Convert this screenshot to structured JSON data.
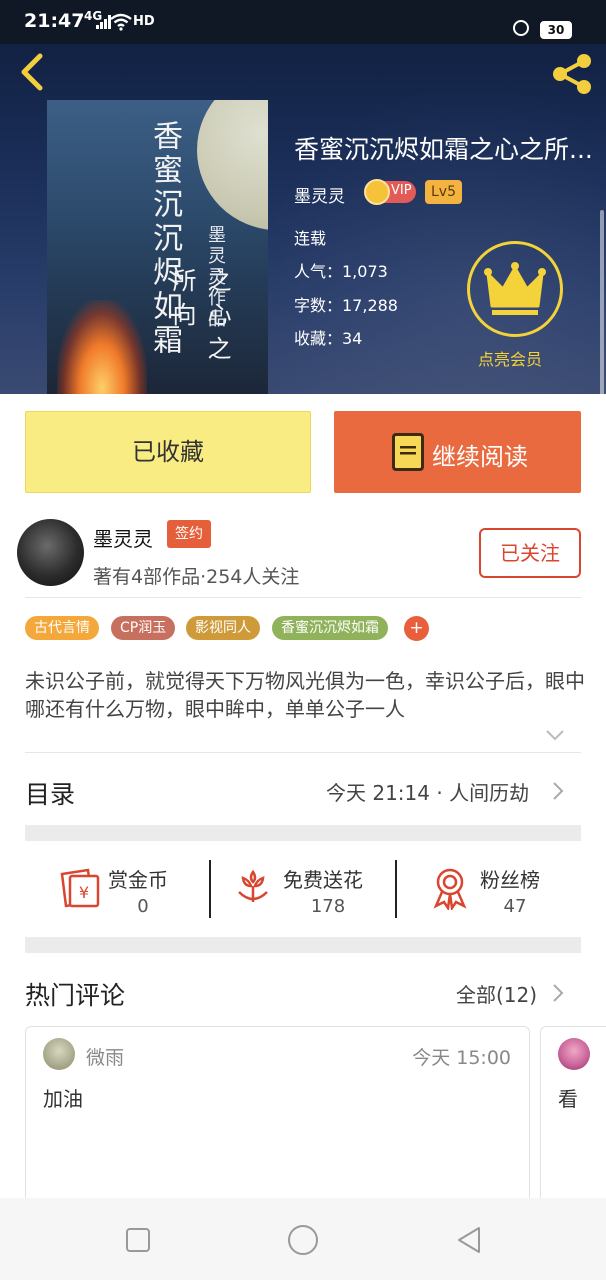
{
  "status_bar": {
    "time": "21:47",
    "network": "4G",
    "hd": "HD",
    "battery": "30"
  },
  "book": {
    "title": "香蜜沉沉烬如霜之心之所...",
    "author": "墨灵灵",
    "vip_label": "VIP",
    "level": "Lv5",
    "status": "连载",
    "popularity": "人气：1,073",
    "word_count": "字数：17,288",
    "favorites": "收藏：34",
    "member_label": "点亮会员",
    "cover": {
      "title": "香蜜沉沉烬如霜",
      "subtitle": "之心之所向",
      "author_line": "墨灵灵作品"
    }
  },
  "actions": {
    "collected": "已收藏",
    "continue_read": "继续阅读"
  },
  "author": {
    "name": "墨灵灵",
    "signed_badge": "签约",
    "stats": "著有4部作品·254人关注",
    "follow": "已关注"
  },
  "tags": [
    {
      "label": "古代言情",
      "color": "#f4a73b"
    },
    {
      "label": "CP润玉",
      "color": "#c7705f"
    },
    {
      "label": "影视同人",
      "color": "#cf9a3a"
    },
    {
      "label": "香蜜沉沉烬如霜",
      "color": "#8fb25a"
    }
  ],
  "tag_more": "+",
  "synopsis": "未识公子前，就觉得天下万物风光俱为一色，幸识公子后，眼中哪还有什么万物，眼中眸中，单单公子一人",
  "catalog": {
    "title": "目录",
    "latest": "今天 21:14 · 人间历劫"
  },
  "tools": [
    {
      "label": "赏金币",
      "count": "0"
    },
    {
      "label": "免费送花",
      "count": "178"
    },
    {
      "label": "粉丝榜",
      "count": "47"
    }
  ],
  "comments": {
    "title": "热门评论",
    "all": "全部(12)",
    "items": [
      {
        "user": "微雨",
        "time": "今天 15:00",
        "text": "加油"
      },
      {
        "user": "",
        "time": "",
        "text": "看"
      }
    ]
  },
  "colors": {
    "accent": "#ea6a40",
    "collected_bg": "#f9ec83",
    "crown": "#f4d23a",
    "red": "#d9462f"
  }
}
